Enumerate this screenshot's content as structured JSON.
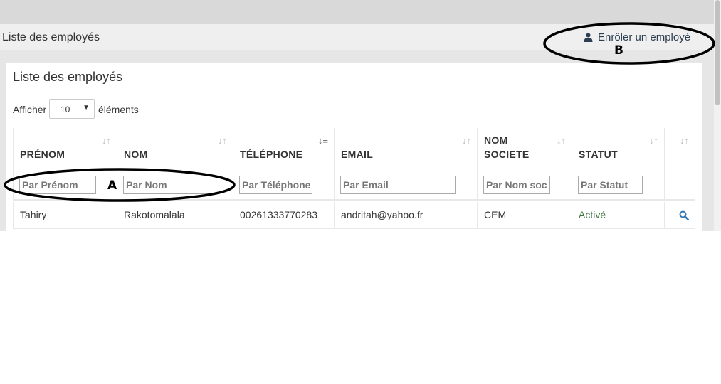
{
  "header": {
    "page_title": "Liste des employés",
    "enroll_label": "Enrôler un employé"
  },
  "panel": {
    "title": "Liste des employés",
    "show_label": "Afficher",
    "page_size": "10",
    "elements_label": "éléments"
  },
  "table": {
    "columns": [
      {
        "label": "PRÉNOM",
        "placeholder": "Par Prénom"
      },
      {
        "label": "NOM",
        "placeholder": "Par Nom"
      },
      {
        "label": "TÉLÉPHONE",
        "placeholder": "Par Téléphone"
      },
      {
        "label": "EMAIL",
        "placeholder": "Par Email"
      },
      {
        "label_line1": "NOM",
        "label_line2": "SOCIETE",
        "placeholder": "Par Nom soci"
      },
      {
        "label": "STATUT",
        "placeholder": "Par Statut"
      },
      {
        "label": ""
      }
    ],
    "rows": [
      {
        "prenom": "Tahiry",
        "nom": "Rakotomalala",
        "telephone": "00261333770283",
        "email": "andritah@yahoo.fr",
        "societe": "CEM",
        "statut": "Activé",
        "action_icon": "search-icon"
      }
    ]
  },
  "annotations": {
    "a": "A",
    "b": "B"
  },
  "colors": {
    "accent": "#2d3e50",
    "status_active": "#3c763d",
    "link_icon": "#337ab7"
  }
}
